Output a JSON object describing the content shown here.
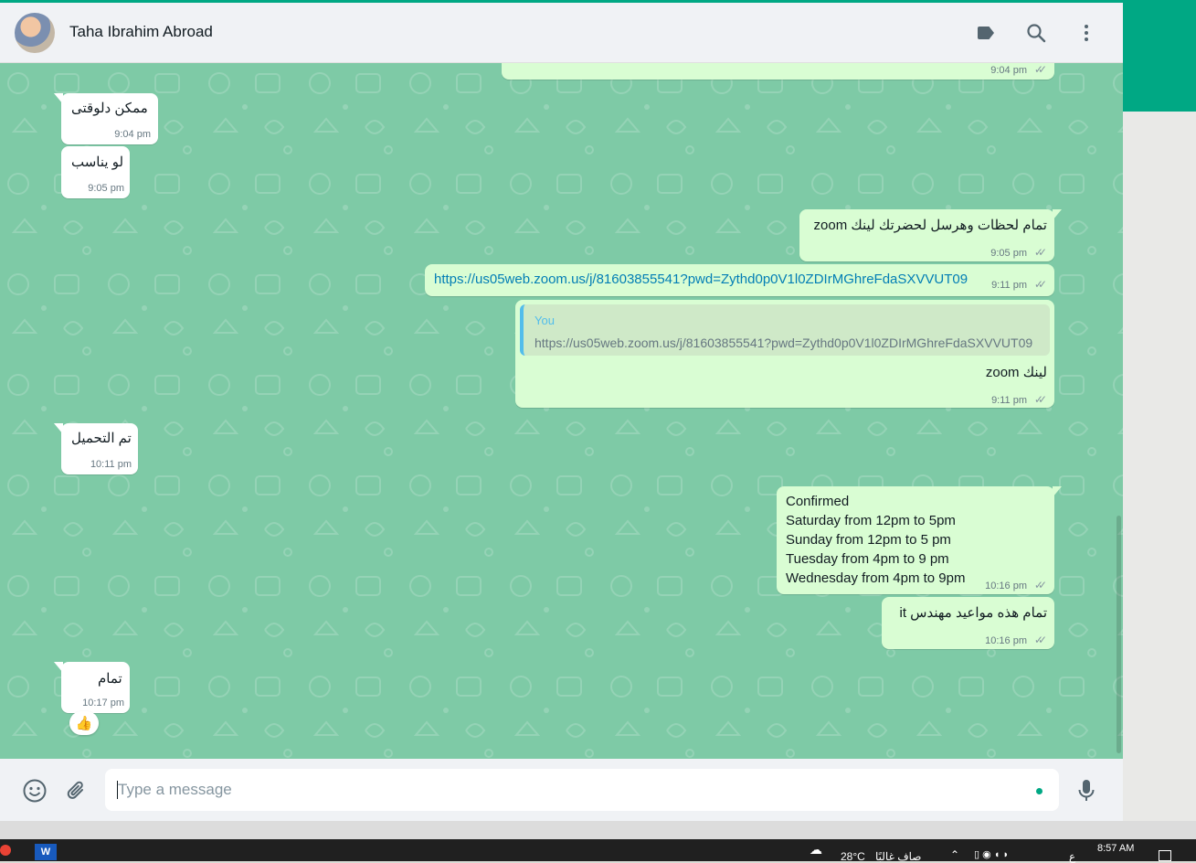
{
  "header": {
    "contact_name": "Taha Ibrahim Abroad",
    "icons": [
      "label-icon",
      "search-icon",
      "menu-icon"
    ]
  },
  "messages": [
    {
      "dir": "out",
      "text": "",
      "time": "9:04 pm",
      "ticks": "read"
    },
    {
      "dir": "in",
      "text": "ممكن دلوقتى",
      "time": "9:04 pm"
    },
    {
      "dir": "in",
      "text": "لو يناسب",
      "time": "9:05 pm"
    },
    {
      "dir": "out",
      "text": "تمام لحظات وهرسل لحضرتك لينك zoom",
      "time": "9:05 pm",
      "ticks": "read"
    },
    {
      "dir": "out",
      "text": "https://us05web.zoom.us/j/81603855541?pwd=Zythd0p0V1l0ZDIrMGhreFdaSXVVUT09",
      "time": "9:11 pm",
      "ticks": "read",
      "is_link": true
    },
    {
      "dir": "out",
      "quote_author": "You",
      "quote_text": "https://us05web.zoom.us/j/81603855541?pwd=Zythd0p0V1l0ZDIrMGhreFdaSXVVUT09",
      "text": "لينك zoom",
      "time": "9:11 pm",
      "ticks": "read"
    },
    {
      "dir": "in",
      "text": "تم التحميل",
      "time": "10:11 pm"
    },
    {
      "dir": "out",
      "text": "Confirmed\nSaturday from 12pm to 5pm\nSunday from 12pm to 5 pm\nTuesday from 4pm to 9 pm\nWednesday from 4pm to 9pm",
      "time": "10:16 pm",
      "ticks": "read"
    },
    {
      "dir": "out",
      "text": "تمام هذه مواعيد مهندس it",
      "time": "10:16 pm",
      "ticks": "read"
    },
    {
      "dir": "in",
      "text": "تمام",
      "time": "10:17 pm",
      "reaction": "👍"
    }
  ],
  "composer": {
    "placeholder": "Type a message",
    "icons": [
      "emoji-icon",
      "attach-icon",
      "mic-icon"
    ]
  },
  "taskbar": {
    "weather": "28°C",
    "weather_text": "صاف غالبًا",
    "lang": "ع",
    "clock": "8:57 AM"
  },
  "colors": {
    "accent": "#00a884",
    "chat_bg": "#7ecaa6",
    "outgoing_bubble": "#d9fdd3",
    "incoming_bubble": "#ffffff",
    "link": "#027eb5"
  }
}
